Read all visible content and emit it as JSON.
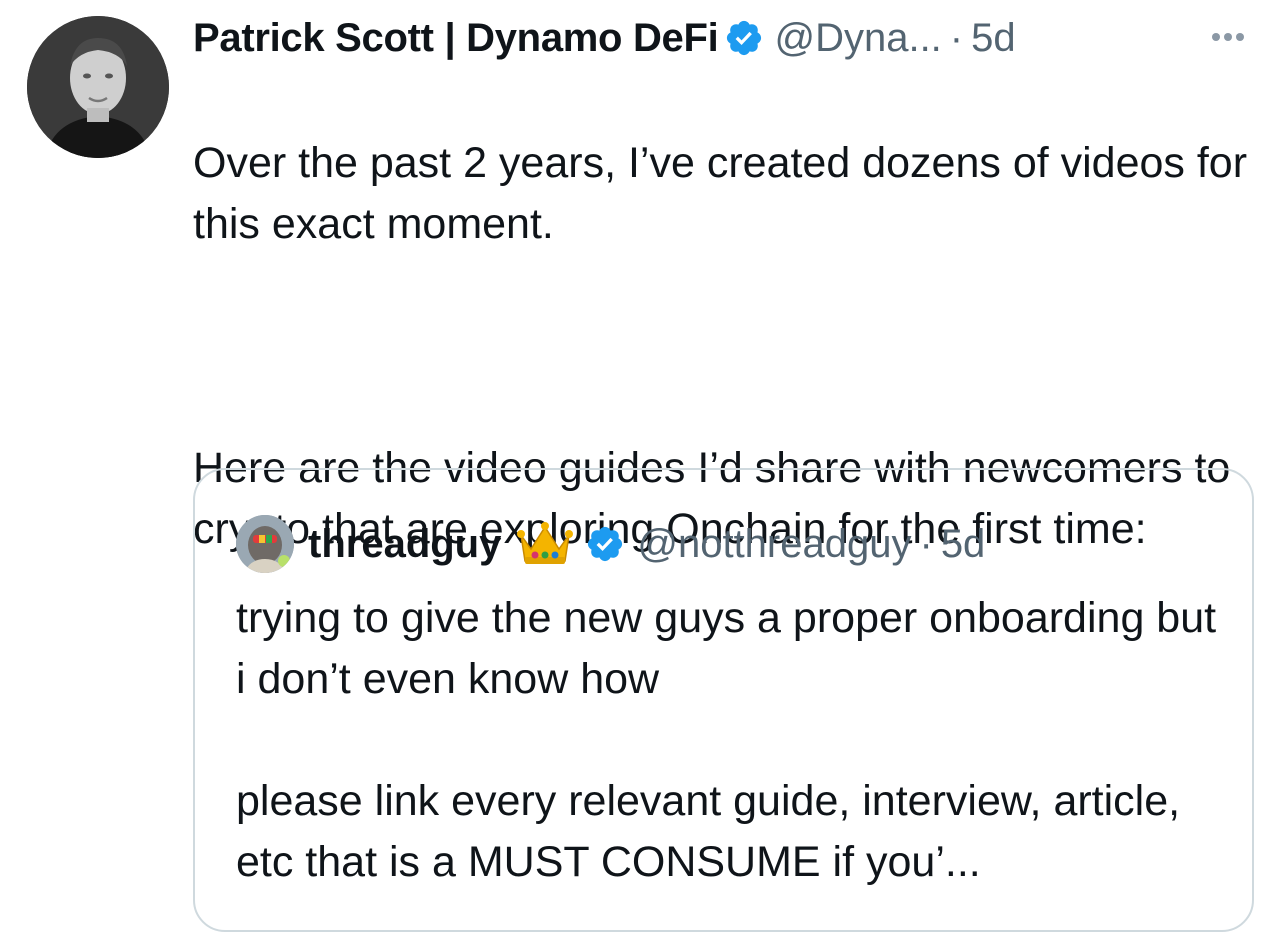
{
  "tweet": {
    "display_name": "Patrick Scott | Dynamo DeFi",
    "handle": "@Dyna...",
    "separator": "·",
    "time": "5d",
    "avatar_icon": "profile-photo",
    "verified_icon": "verified-badge-icon",
    "more_icon": "more-options-icon",
    "text_lines": {
      "p1": "Over the past 2 years, I’ve created dozens of videos for this exact moment.",
      "p2": "Here are the video guides I’d share with newcomers to crypto that are exploring Onchain for the first time:"
    }
  },
  "quote": {
    "display_name": "threadguy",
    "emoji": "👑",
    "handle": "@notthreadguy",
    "separator": "·",
    "time": "5d",
    "avatar_icon": "profile-photo",
    "verified_icon": "verified-badge-icon",
    "text_lines": {
      "p1": "trying to give the new guys a proper onboarding but i don’t even know how",
      "p2": "please link every relevant guide, interview, article, etc that is a MUST CONSUME if you’..."
    }
  },
  "colors": {
    "text_primary": "#0f1419",
    "text_secondary": "#536471",
    "verified_blue": "#1d9bf0",
    "border": "#cfd9de"
  }
}
